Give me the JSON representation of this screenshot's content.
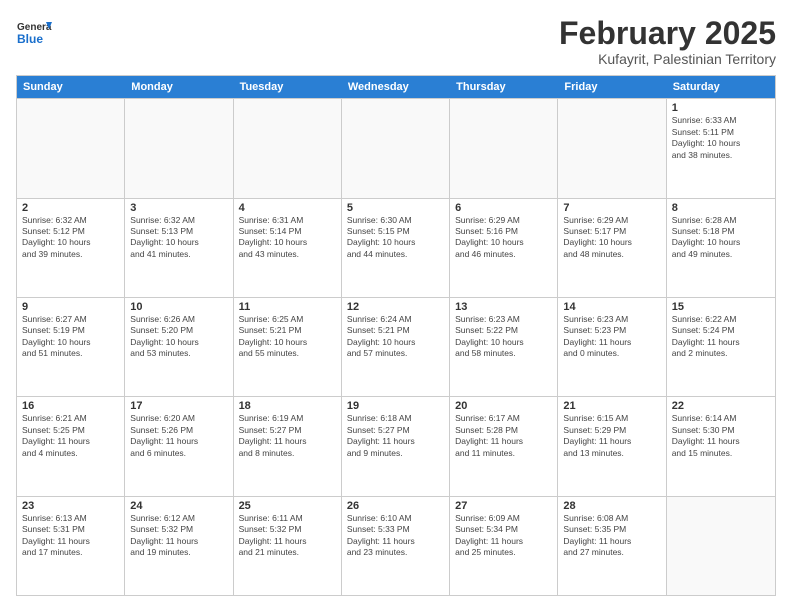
{
  "logo": {
    "general": "General",
    "blue": "Blue"
  },
  "title": "February 2025",
  "subtitle": "Kufayrit, Palestinian Territory",
  "header_days": [
    "Sunday",
    "Monday",
    "Tuesday",
    "Wednesday",
    "Thursday",
    "Friday",
    "Saturday"
  ],
  "weeks": [
    [
      {
        "day": "",
        "info": ""
      },
      {
        "day": "",
        "info": ""
      },
      {
        "day": "",
        "info": ""
      },
      {
        "day": "",
        "info": ""
      },
      {
        "day": "",
        "info": ""
      },
      {
        "day": "",
        "info": ""
      },
      {
        "day": "1",
        "info": "Sunrise: 6:33 AM\nSunset: 5:11 PM\nDaylight: 10 hours\nand 38 minutes."
      }
    ],
    [
      {
        "day": "2",
        "info": "Sunrise: 6:32 AM\nSunset: 5:12 PM\nDaylight: 10 hours\nand 39 minutes."
      },
      {
        "day": "3",
        "info": "Sunrise: 6:32 AM\nSunset: 5:13 PM\nDaylight: 10 hours\nand 41 minutes."
      },
      {
        "day": "4",
        "info": "Sunrise: 6:31 AM\nSunset: 5:14 PM\nDaylight: 10 hours\nand 43 minutes."
      },
      {
        "day": "5",
        "info": "Sunrise: 6:30 AM\nSunset: 5:15 PM\nDaylight: 10 hours\nand 44 minutes."
      },
      {
        "day": "6",
        "info": "Sunrise: 6:29 AM\nSunset: 5:16 PM\nDaylight: 10 hours\nand 46 minutes."
      },
      {
        "day": "7",
        "info": "Sunrise: 6:29 AM\nSunset: 5:17 PM\nDaylight: 10 hours\nand 48 minutes."
      },
      {
        "day": "8",
        "info": "Sunrise: 6:28 AM\nSunset: 5:18 PM\nDaylight: 10 hours\nand 49 minutes."
      }
    ],
    [
      {
        "day": "9",
        "info": "Sunrise: 6:27 AM\nSunset: 5:19 PM\nDaylight: 10 hours\nand 51 minutes."
      },
      {
        "day": "10",
        "info": "Sunrise: 6:26 AM\nSunset: 5:20 PM\nDaylight: 10 hours\nand 53 minutes."
      },
      {
        "day": "11",
        "info": "Sunrise: 6:25 AM\nSunset: 5:21 PM\nDaylight: 10 hours\nand 55 minutes."
      },
      {
        "day": "12",
        "info": "Sunrise: 6:24 AM\nSunset: 5:21 PM\nDaylight: 10 hours\nand 57 minutes."
      },
      {
        "day": "13",
        "info": "Sunrise: 6:23 AM\nSunset: 5:22 PM\nDaylight: 10 hours\nand 58 minutes."
      },
      {
        "day": "14",
        "info": "Sunrise: 6:23 AM\nSunset: 5:23 PM\nDaylight: 11 hours\nand 0 minutes."
      },
      {
        "day": "15",
        "info": "Sunrise: 6:22 AM\nSunset: 5:24 PM\nDaylight: 11 hours\nand 2 minutes."
      }
    ],
    [
      {
        "day": "16",
        "info": "Sunrise: 6:21 AM\nSunset: 5:25 PM\nDaylight: 11 hours\nand 4 minutes."
      },
      {
        "day": "17",
        "info": "Sunrise: 6:20 AM\nSunset: 5:26 PM\nDaylight: 11 hours\nand 6 minutes."
      },
      {
        "day": "18",
        "info": "Sunrise: 6:19 AM\nSunset: 5:27 PM\nDaylight: 11 hours\nand 8 minutes."
      },
      {
        "day": "19",
        "info": "Sunrise: 6:18 AM\nSunset: 5:27 PM\nDaylight: 11 hours\nand 9 minutes."
      },
      {
        "day": "20",
        "info": "Sunrise: 6:17 AM\nSunset: 5:28 PM\nDaylight: 11 hours\nand 11 minutes."
      },
      {
        "day": "21",
        "info": "Sunrise: 6:15 AM\nSunset: 5:29 PM\nDaylight: 11 hours\nand 13 minutes."
      },
      {
        "day": "22",
        "info": "Sunrise: 6:14 AM\nSunset: 5:30 PM\nDaylight: 11 hours\nand 15 minutes."
      }
    ],
    [
      {
        "day": "23",
        "info": "Sunrise: 6:13 AM\nSunset: 5:31 PM\nDaylight: 11 hours\nand 17 minutes."
      },
      {
        "day": "24",
        "info": "Sunrise: 6:12 AM\nSunset: 5:32 PM\nDaylight: 11 hours\nand 19 minutes."
      },
      {
        "day": "25",
        "info": "Sunrise: 6:11 AM\nSunset: 5:32 PM\nDaylight: 11 hours\nand 21 minutes."
      },
      {
        "day": "26",
        "info": "Sunrise: 6:10 AM\nSunset: 5:33 PM\nDaylight: 11 hours\nand 23 minutes."
      },
      {
        "day": "27",
        "info": "Sunrise: 6:09 AM\nSunset: 5:34 PM\nDaylight: 11 hours\nand 25 minutes."
      },
      {
        "day": "28",
        "info": "Sunrise: 6:08 AM\nSunset: 5:35 PM\nDaylight: 11 hours\nand 27 minutes."
      },
      {
        "day": "",
        "info": ""
      }
    ]
  ]
}
